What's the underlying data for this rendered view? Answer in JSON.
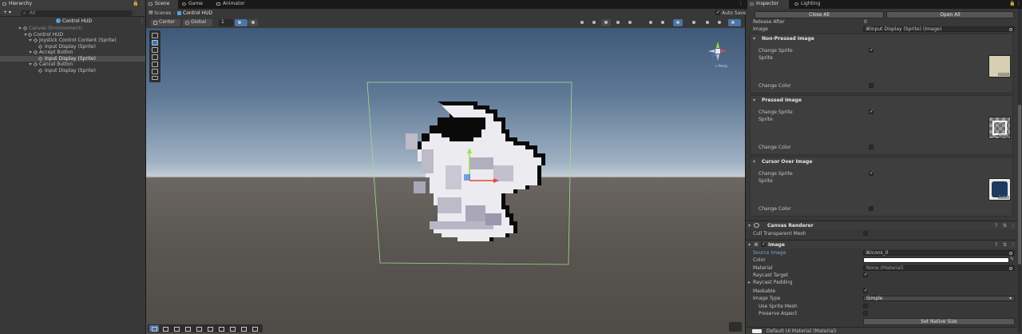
{
  "hierarchy": {
    "tab_label": "Hierarchy",
    "add_label": "+ ▾",
    "search_placeholder": "All",
    "scene_root": "Control HUD",
    "items": [
      {
        "label": "Canvas (Environment)"
      },
      {
        "label": "Control HUD"
      },
      {
        "label": "Joystick Control Content (Sprite)"
      },
      {
        "label": "Input Display (Sprite)"
      },
      {
        "label": "Accept Button"
      },
      {
        "label": "Input Display (Sprite)"
      },
      {
        "label": "Cancel Button"
      },
      {
        "label": "Input Display (Sprite)"
      }
    ]
  },
  "scene": {
    "tabs": [
      "Scene",
      "Game",
      "Animator"
    ],
    "breadcrumb": {
      "scenes": "Scenes",
      "current": "Control HUD"
    },
    "auto_save_label": "Auto Save",
    "pivot_label": "Center",
    "space_label": "Global",
    "grid_value": "1",
    "persp_label": "< Persp"
  },
  "inspector": {
    "tabs": [
      "Inspector",
      "Lighting"
    ],
    "close_all": "Close All",
    "open_all": "Open All",
    "release_after_label": "Release After",
    "release_after_value": "0",
    "image_label": "Image",
    "image_value": "Input Display (Sprite) (Image)",
    "sections": [
      {
        "title": "Non-Pressed Image",
        "change_sprite": "Change Sprite",
        "sprite": "Sprite",
        "change_color": "Change Color",
        "swatch": "#d6cfb4"
      },
      {
        "title": "Pressed Image",
        "change_sprite": "Change Sprite",
        "sprite": "Sprite",
        "change_color": "Change Color",
        "swatch": "#808080"
      },
      {
        "title": "Cursor Over Image",
        "change_sprite": "Change Sprite",
        "sprite": "Sprite",
        "change_color": "Change Color",
        "swatch": "#1f3a5f"
      }
    ],
    "select_label": "Select",
    "canvas_renderer": {
      "title": "Canvas Renderer",
      "cull_label": "Cull Transparent Mesh"
    },
    "image_component": {
      "title": "Image",
      "source_image_label": "Source Image",
      "source_image_value": "Icons_0",
      "color_label": "Color",
      "material_label": "Material",
      "material_value": "None (Material)",
      "raycast_target_label": "Raycast Target",
      "raycast_padding_label": "Raycast Padding",
      "maskable_label": "Maskable",
      "image_type_label": "Image Type",
      "image_type_value": "Simple",
      "use_sprite_mesh_label": "Use Sprite Mesh",
      "preserve_aspect_label": "Preserve Aspect",
      "set_native_size": "Set Native Size"
    },
    "default_material": "Default UI Material (Material)"
  },
  "colors": {
    "accent": "#4a75a8",
    "link": "#7aa7e0"
  }
}
